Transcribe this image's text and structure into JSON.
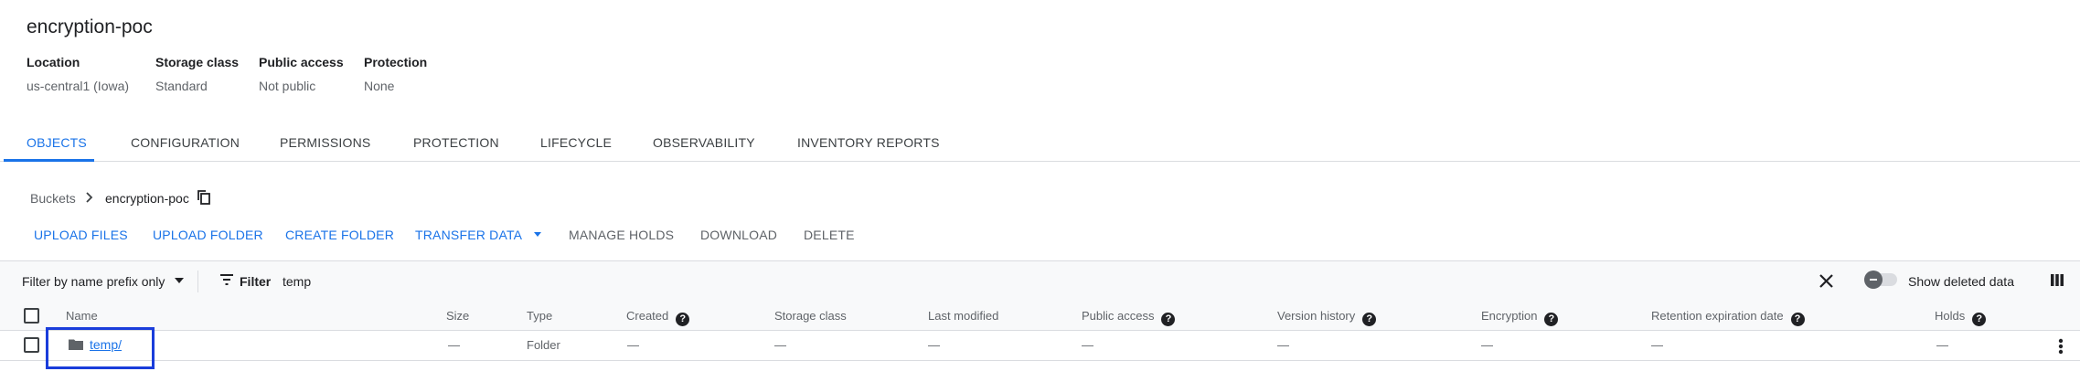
{
  "bucket": {
    "title": "encryption-poc",
    "meta": [
      {
        "label": "Location",
        "value": "us-central1 (Iowa)"
      },
      {
        "label": "Storage class",
        "value": "Standard"
      },
      {
        "label": "Public access",
        "value": "Not public"
      },
      {
        "label": "Protection",
        "value": "None"
      }
    ]
  },
  "tabs": [
    "OBJECTS",
    "CONFIGURATION",
    "PERMISSIONS",
    "PROTECTION",
    "LIFECYCLE",
    "OBSERVABILITY",
    "INVENTORY REPORTS"
  ],
  "active_tab": "OBJECTS",
  "breadcrumb": {
    "root": "Buckets",
    "current": "encryption-poc"
  },
  "actions": {
    "upload_files": "UPLOAD FILES",
    "upload_folder": "UPLOAD FOLDER",
    "create_folder": "CREATE FOLDER",
    "transfer_data": "TRANSFER DATA",
    "manage_holds": "MANAGE HOLDS",
    "download": "DOWNLOAD",
    "delete": "DELETE"
  },
  "filter": {
    "mode": "Filter by name prefix only",
    "label": "Filter",
    "value": "temp",
    "show_deleted": "Show deleted data"
  },
  "columns": [
    "Name",
    "Size",
    "Type",
    "Created",
    "Storage class",
    "Last modified",
    "Public access",
    "Version history",
    "Encryption",
    "Retention expiration date",
    "Holds"
  ],
  "rows": [
    {
      "name": "temp/",
      "size": "—",
      "type": "Folder",
      "created": "—",
      "storage_class": "—",
      "last_modified": "—",
      "public_access": "—",
      "version_history": "—",
      "encryption": "—",
      "retention": "—",
      "holds": "—"
    }
  ],
  "colors": {
    "accent": "#1a73e8",
    "highlight": "#1a3ddb"
  }
}
